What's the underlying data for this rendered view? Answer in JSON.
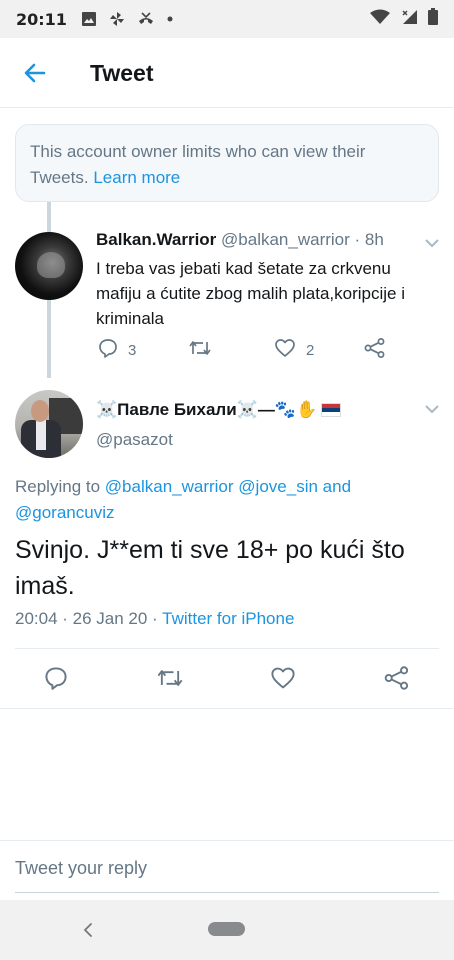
{
  "status_bar": {
    "time": "20:11"
  },
  "app_bar": {
    "title": "Tweet"
  },
  "notice": {
    "text": "This account owner limits who can view their Tweets.",
    "link": "Learn more"
  },
  "parent_tweet": {
    "name": "Balkan.Warrior",
    "handle": "@balkan_warrior",
    "time": "· 8h",
    "text": "I treba vas jebati kad šetate za crkvenu mafiju a ćutite zbog malih plata,koripcije i kriminala",
    "replies": "3",
    "likes": "2"
  },
  "main_tweet": {
    "name": "Павле Бихали",
    "handle": "@pasazot",
    "replying_prefix": "Replying to",
    "mention1": "@balkan_warrior",
    "mention2": "@jove_sin",
    "and_word": "and",
    "mention3": "@gorancuviz",
    "text": "Svinjo. J**em ti sve 18+ po kući što imaš.",
    "timestamp": "20:04 · 26 Jan 20 ·",
    "source": "Twitter for iPhone"
  },
  "compose": {
    "placeholder": "Tweet your reply"
  },
  "colors": {
    "accent": "#1b95e0",
    "muted": "#657786",
    "text": "#14171a"
  }
}
